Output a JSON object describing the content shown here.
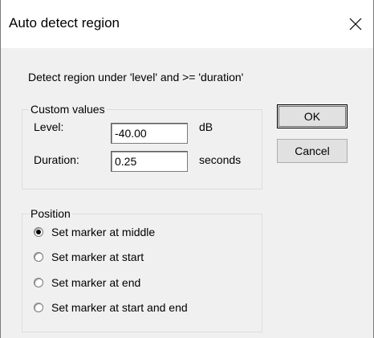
{
  "window": {
    "title": "Auto detect region",
    "close_glyph": "✕",
    "close_icon": "close-icon"
  },
  "description": "Detect region under 'level' and >=  'duration'",
  "custom_values": {
    "legend": "Custom values",
    "level_label": "Level:",
    "level_value": "-40.00",
    "level_unit": "dB",
    "duration_label": "Duration:",
    "duration_value": "0.25",
    "duration_unit": "seconds"
  },
  "buttons": {
    "ok": "OK",
    "cancel": "Cancel"
  },
  "position": {
    "legend": "Position",
    "options": [
      {
        "label": "Set marker at middle",
        "checked": true
      },
      {
        "label": "Set marker at start",
        "checked": false
      },
      {
        "label": "Set marker at end",
        "checked": false
      },
      {
        "label": "Set marker at start and end",
        "checked": false
      }
    ]
  }
}
